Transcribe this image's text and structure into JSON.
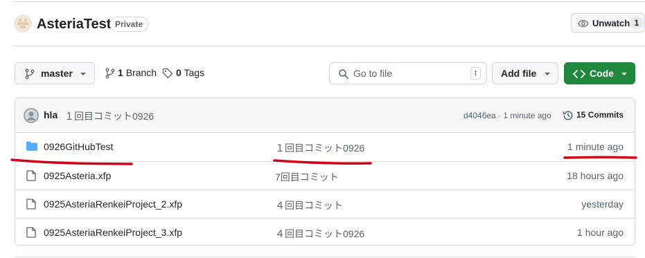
{
  "repo": {
    "name": "AsteriaTest",
    "visibility": "Private",
    "watch_label": "Unwatch",
    "watch_count": "1"
  },
  "toolbar": {
    "branch": "master",
    "branches_count": "1",
    "branches_label": "Branch",
    "tags_count": "0",
    "tags_label": "Tags",
    "goto_placeholder": "Go to file",
    "goto_shortcut": "t",
    "add_file_label": "Add file",
    "code_label": "Code"
  },
  "latest_commit": {
    "author": "hla",
    "message": "１回目コミット0926",
    "hash_time": "d4046ea · 1 minute ago",
    "commits_count": "15",
    "commits_label": "Commits"
  },
  "files": [
    {
      "type": "folder",
      "name": "0926GitHubTest",
      "message": "１回目コミット0926",
      "time": "1 minute ago"
    },
    {
      "type": "file",
      "name": "0925Asteria.xfp",
      "message": "7回目コミット",
      "time": "18 hours ago"
    },
    {
      "type": "file",
      "name": "0925AsteriaRenkeiProject_2.xfp",
      "message": "４回目コミット",
      "time": "yesterday"
    },
    {
      "type": "file",
      "name": "0925AsteriaRenkeiProject_3.xfp",
      "message": "４回目コミット0926",
      "time": "1 hour ago"
    }
  ],
  "colors": {
    "code_button": "#1f883d",
    "folder_icon": "#54aeff",
    "annotation": "#d0021b"
  }
}
